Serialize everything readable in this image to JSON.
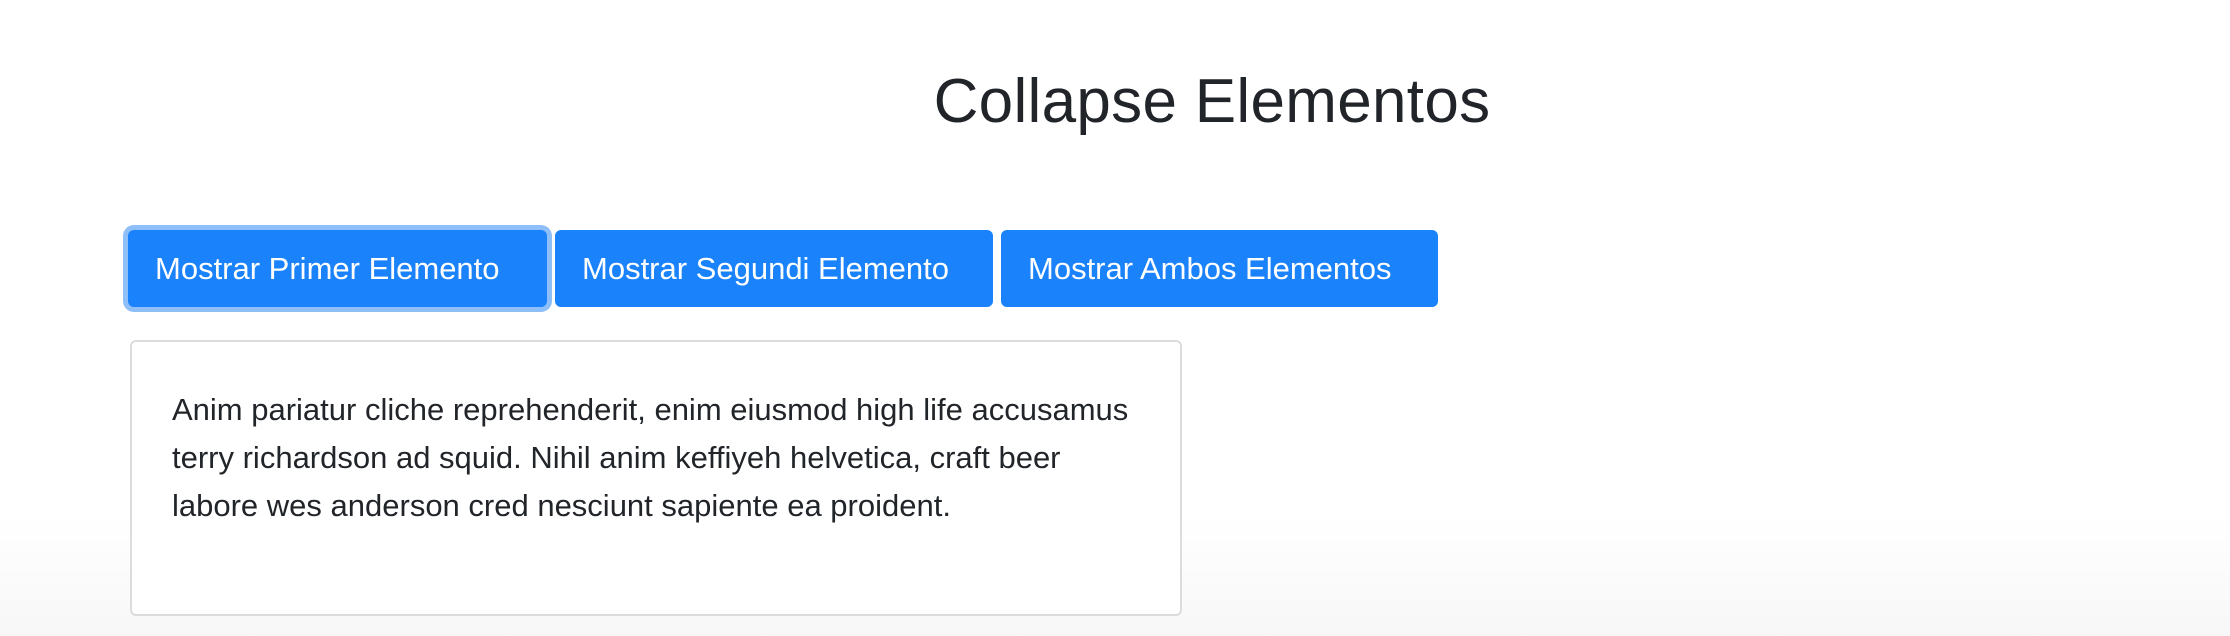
{
  "page": {
    "title": "Collapse Elementos"
  },
  "buttons": {
    "first": "Mostrar Primer Elemento",
    "second": "Mostrar Segundi Elemento",
    "both": "Mostrar Ambos Elementos"
  },
  "collapse": {
    "text": "Anim pariatur cliche reprehenderit, enim eiusmod high life accusamus terry richardson ad squid. Nihil anim keffiyeh helvetica, craft beer labore wes anderson cred nesciunt sapiente ea proident."
  },
  "colors": {
    "primary": "#1a82fb",
    "text": "#212529",
    "focus_ring": "#8fbff8",
    "card_border": "#dcdcdc"
  }
}
